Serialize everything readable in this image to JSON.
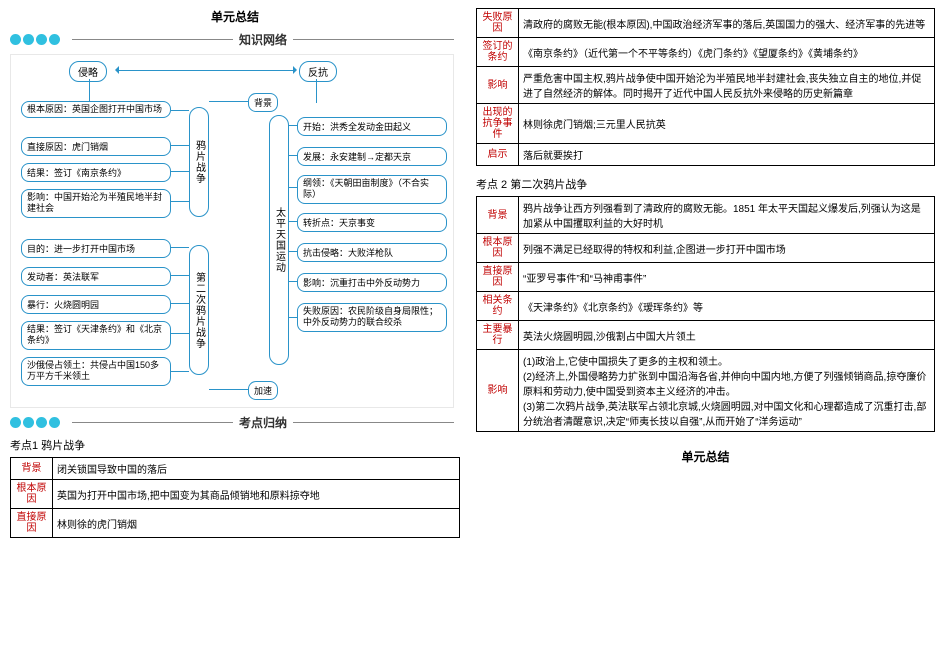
{
  "title": "单元总结",
  "section_network": "知识网络",
  "section_points": "考点归纳",
  "diagram": {
    "top_left": "侵略",
    "top_right": "反抗",
    "label_bg": "背景",
    "label_acc": "加速",
    "col1": "鸦片战争",
    "col2": "第二次鸦片战争",
    "col3": "太平天国运动",
    "left": {
      "l1": "根本原因：英国企图打开中国市场",
      "l2": "直接原因：虎门销烟",
      "l3": "结果：签订《南京条约》",
      "l4": "影响：中国开始沦为半殖民地半封建社会",
      "l5": "目的：进一步打开中国市场",
      "l6": "发动者：英法联军",
      "l7": "暴行：火烧圆明园",
      "l8": "结果：签订《天津条约》和《北京条约》",
      "l9": "沙俄侵占领土：共侵占中国150多万平方千米领土"
    },
    "right": {
      "r1": "开始：洪秀全发动金田起义",
      "r2": "发展：永安建制→定都天京",
      "r3": "纲领：《天朝田亩制度》（不合实际）",
      "r4": "转折点：天京事变",
      "r5": "抗击侵略：大败洋枪队",
      "r6": "影响：沉重打击中外反动势力",
      "r7": "失败原因：农民阶级自身局限性；中外反动势力的联合绞杀"
    }
  },
  "kd1_title": "考点1  鸦片战争",
  "kd1": {
    "r1h": "背景",
    "r1v": "闭关锁国导致中国的落后",
    "r2h": "根本原因",
    "r2v": "英国为打开中国市场,把中国变为其商品倾销地和原料掠夺地",
    "r3h": "直接原因",
    "r3v": "林则徐的虎门销烟"
  },
  "kd1b": {
    "r1h": "失败原因",
    "r1v": "清政府的腐败无能(根本原因),中国政治经济军事的落后,英国国力的强大、经济军事的先进等",
    "r2h": "签订的条约",
    "r2v": "《南京条约》（近代第一个不平等条约）《虎门条约》《望厦条约》《黄埔条约》",
    "r3h": "影响",
    "r3v": "严重危害中国主权,鸦片战争使中国开始沦为半殖民地半封建社会,丧失独立自主的地位,并促进了自然经济的解体。同时揭开了近代中国人民反抗外来侵略的历史新篇章",
    "r4h": "出现的抗争事件",
    "r4v": "林则徐虎门销烟;三元里人民抗英",
    "r5h": "启示",
    "r5v": "落后就要挨打"
  },
  "kd2_title": "考点 2  第二次鸦片战争",
  "kd2": {
    "r1h": "背景",
    "r1v": "鸦片战争让西方列强看到了清政府的腐败无能。1851 年太平天国起义爆发后,列强认为这是加紧从中国攫取利益的大好时机",
    "r2h": "根本原因",
    "r2v": "列强不满足已经取得的特权和利益,企图进一步打开中国市场",
    "r3h": "直接原因",
    "r3v": "“亚罗号事件”和“马神甫事件”",
    "r4h": "相关条约",
    "r4v": "《天津条约》《北京条约》《瑷珲条约》等",
    "r5h": "主要暴行",
    "r5v": "英法火烧圆明园,沙俄割占中国大片领土",
    "r6h": "影响",
    "r6v": "(1)政治上,它使中国损失了更多的主权和领土。\n(2)经济上,外国侵略势力扩张到中国沿海各省,并伸向中国内地,方便了列强倾销商品,掠夺廉价原料和劳动力,使中国受到资本主义经济的冲击。\n(3)第二次鸦片战争,英法联军占领北京城,火烧圆明园,对中国文化和心理都造成了沉重打击,部分统治者清醒意识,决定“师夷长技以自强”,从而开始了“洋务运动”"
  },
  "footer_title": "单元总结"
}
